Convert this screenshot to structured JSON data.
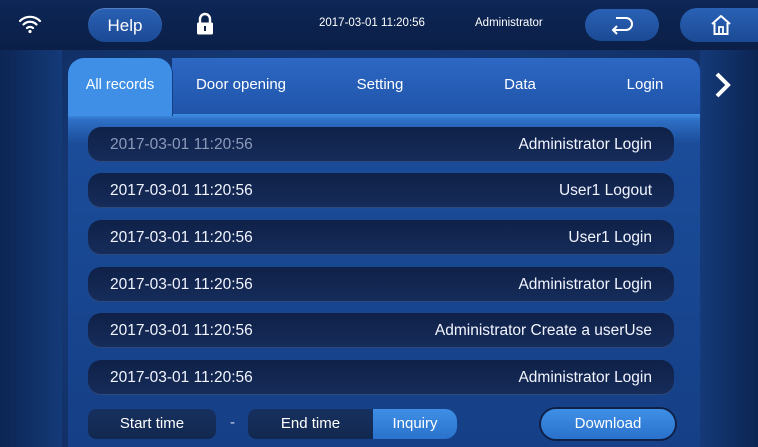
{
  "header": {
    "help_label": "Help",
    "datetime": "2017-03-01  11:20:56",
    "user": "Administrator",
    "icons": {
      "wifi": "wifi-icon",
      "lock": "lock-icon",
      "back": "back-arrow-icon",
      "home": "home-icon",
      "next": "chevron-right-icon"
    }
  },
  "tabs": [
    {
      "label": "All records",
      "active": true
    },
    {
      "label": "Door opening",
      "active": false
    },
    {
      "label": "Setting",
      "active": false
    },
    {
      "label": "Data",
      "active": false
    },
    {
      "label": "Login",
      "active": false
    }
  ],
  "records": [
    {
      "time": "2017-03-01  11:20:56",
      "event": "Administrator Login"
    },
    {
      "time": "2017-03-01  11:20:56",
      "event": "User1 Logout"
    },
    {
      "time": "2017-03-01  11:20:56",
      "event": "User1 Login"
    },
    {
      "time": "2017-03-01  11:20:56",
      "event": "Administrator Login"
    },
    {
      "time": "2017-03-01  11:20:56",
      "event": "Administrator Create a userUse"
    },
    {
      "time": "2017-03-01  11:20:56",
      "event": "Administrator Login"
    }
  ],
  "filter": {
    "start_label": "Start time",
    "separator": "-",
    "end_label": "End time",
    "inquiry_label": "Inquiry",
    "download_label": "Download"
  },
  "colors": {
    "accent": "#3f8fe6",
    "background": "#163b7a",
    "row": "#12264f"
  }
}
